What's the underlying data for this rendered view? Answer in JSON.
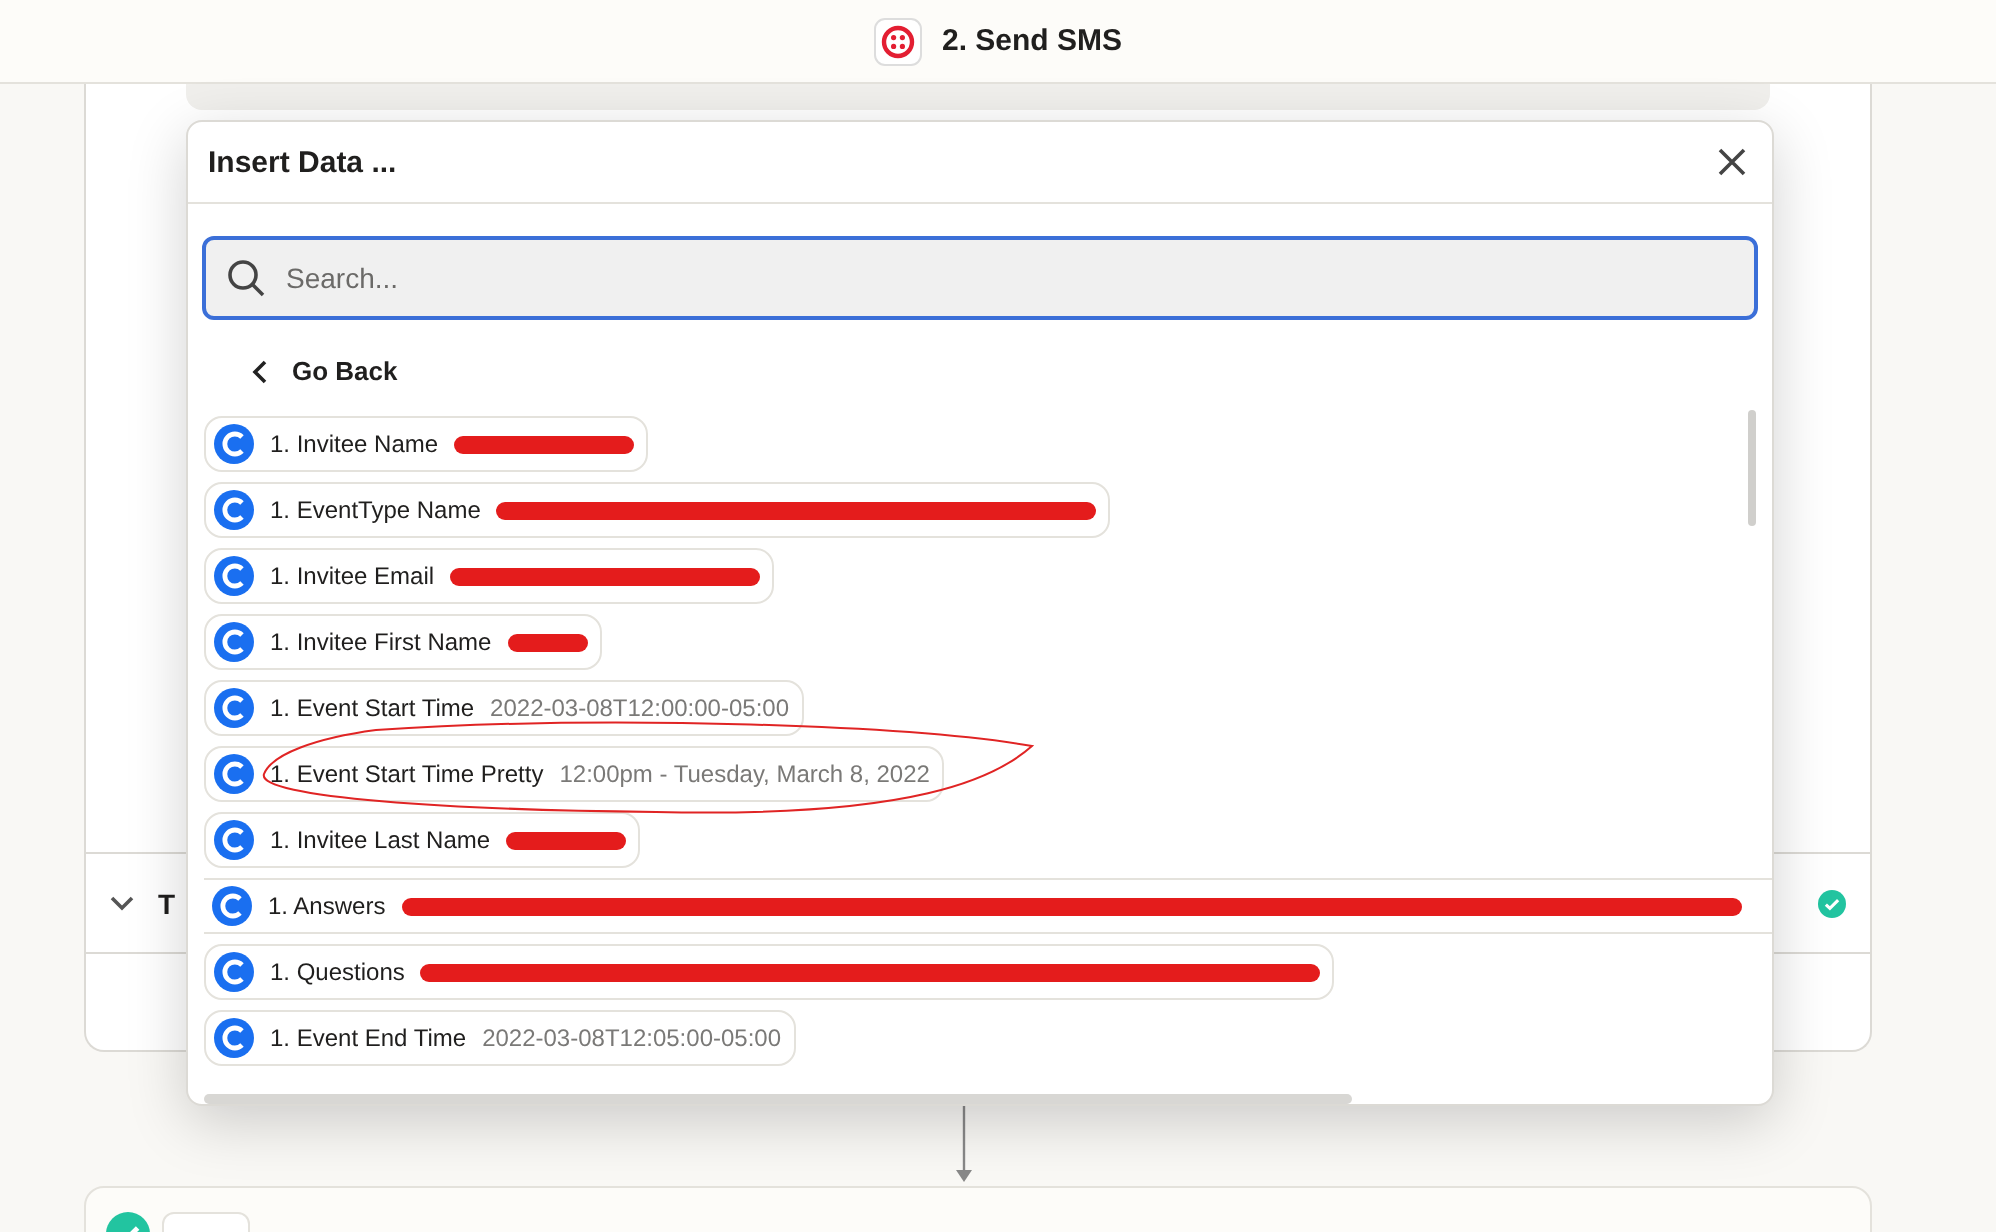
{
  "header": {
    "title": "2. Send SMS"
  },
  "card": {
    "step_title": "T",
    "step_done": true
  },
  "modal": {
    "title": "Insert Data ...",
    "search": {
      "placeholder": "Search..."
    },
    "back_label": "Go Back",
    "items": [
      {
        "label": "1. Invitee Name",
        "redacted": true,
        "circled": false
      },
      {
        "label": "1. EventType Name",
        "redacted": true,
        "circled": false
      },
      {
        "label": "1. Invitee Email",
        "redacted": true,
        "circled": false
      },
      {
        "label": "1. Invitee First Name",
        "redacted": true,
        "circled": false
      },
      {
        "label": "1. Event Start Time",
        "value": "2022-03-08T12:00:00-05:00",
        "redacted": false,
        "circled": false
      },
      {
        "label": "1. Event Start Time Pretty",
        "value": "12:00pm - Tuesday, March 8, 2022",
        "redacted": false,
        "circled": true
      },
      {
        "label": "1. Invitee Last Name",
        "redacted": true,
        "circled": false
      },
      {
        "label": "1. Answers",
        "redacted": true,
        "circled": false
      },
      {
        "label": "1. Questions",
        "redacted": true,
        "circled": false
      },
      {
        "label": "1. Event End Time",
        "value": "2022-03-08T12:05:00-05:00",
        "redacted": false,
        "circled": false
      }
    ]
  },
  "next_step": {
    "done": true
  }
}
